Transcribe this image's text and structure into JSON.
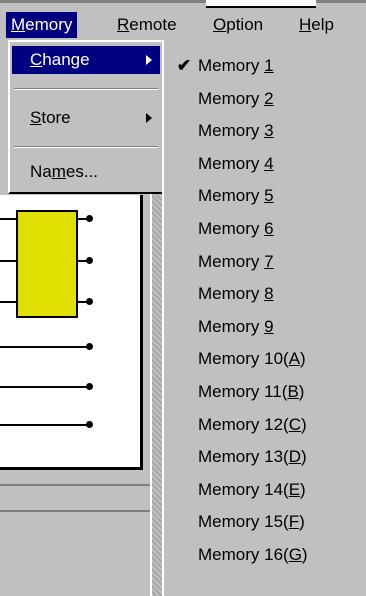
{
  "menubar": {
    "items": [
      {
        "pre": "",
        "u": "M",
        "post": "emory"
      },
      {
        "pre": "",
        "u": "R",
        "post": "emote"
      },
      {
        "pre": "",
        "u": "O",
        "post": "ption"
      },
      {
        "pre": "",
        "u": "H",
        "post": "elp"
      }
    ]
  },
  "memory_menu": {
    "items": [
      {
        "pre": "",
        "u": "C",
        "post": "hange",
        "submenu": true
      },
      {
        "pre": "",
        "u": "S",
        "post": "tore",
        "submenu": true
      },
      {
        "pre": "Na",
        "u": "m",
        "post": "es..."
      }
    ]
  },
  "submenu": {
    "checked_index": 0,
    "check_glyph": "✔",
    "items": [
      {
        "pre": "Memory ",
        "u": "1",
        "post": ""
      },
      {
        "pre": "Memory ",
        "u": "2",
        "post": ""
      },
      {
        "pre": "Memory ",
        "u": "3",
        "post": ""
      },
      {
        "pre": "Memory ",
        "u": "4",
        "post": ""
      },
      {
        "pre": "Memory ",
        "u": "5",
        "post": ""
      },
      {
        "pre": "Memory ",
        "u": "6",
        "post": ""
      },
      {
        "pre": "Memory ",
        "u": "7",
        "post": ""
      },
      {
        "pre": "Memory ",
        "u": "8",
        "post": ""
      },
      {
        "pre": "Memory ",
        "u": "9",
        "post": ""
      },
      {
        "pre": "Memory 10(",
        "u": "A",
        "post": ")"
      },
      {
        "pre": "Memory 11(",
        "u": "B",
        "post": ")"
      },
      {
        "pre": "Memory 12(",
        "u": "C",
        "post": ")"
      },
      {
        "pre": "Memory 13(",
        "u": "D",
        "post": ")"
      },
      {
        "pre": "Memory 14(",
        "u": "E",
        "post": ")"
      },
      {
        "pre": "Memory 15(",
        "u": "F",
        "post": ")"
      },
      {
        "pre": "Memory 16(",
        "u": "G",
        "post": ")"
      }
    ]
  },
  "colors": {
    "highlight": "#000080",
    "face": "#c0c0c0",
    "component": "#e0e000"
  }
}
